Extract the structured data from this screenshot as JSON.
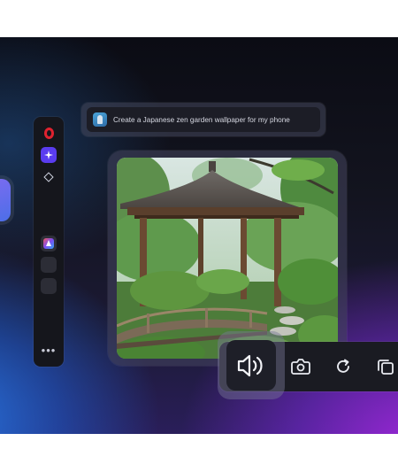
{
  "prompt": {
    "text": "Create a Japanese zen garden  wallpaper for my phone"
  },
  "sidebar": {
    "items": [
      {
        "icon": "opera-icon"
      },
      {
        "icon": "aria-sparkle-icon"
      },
      {
        "icon": "diamond-icon"
      },
      {
        "icon": "app-icon"
      },
      {
        "icon": "empty-slot"
      },
      {
        "icon": "empty-slot"
      }
    ],
    "more_label": "•••"
  },
  "image": {
    "subject": "japanese-zen-garden-pavilion"
  },
  "toolbar": {
    "actions": [
      "speaker-icon",
      "camera-icon",
      "refresh-icon",
      "copy-icon"
    ]
  },
  "colors": {
    "accent": "#5a3cf0",
    "opera_red": "#e0222f"
  }
}
